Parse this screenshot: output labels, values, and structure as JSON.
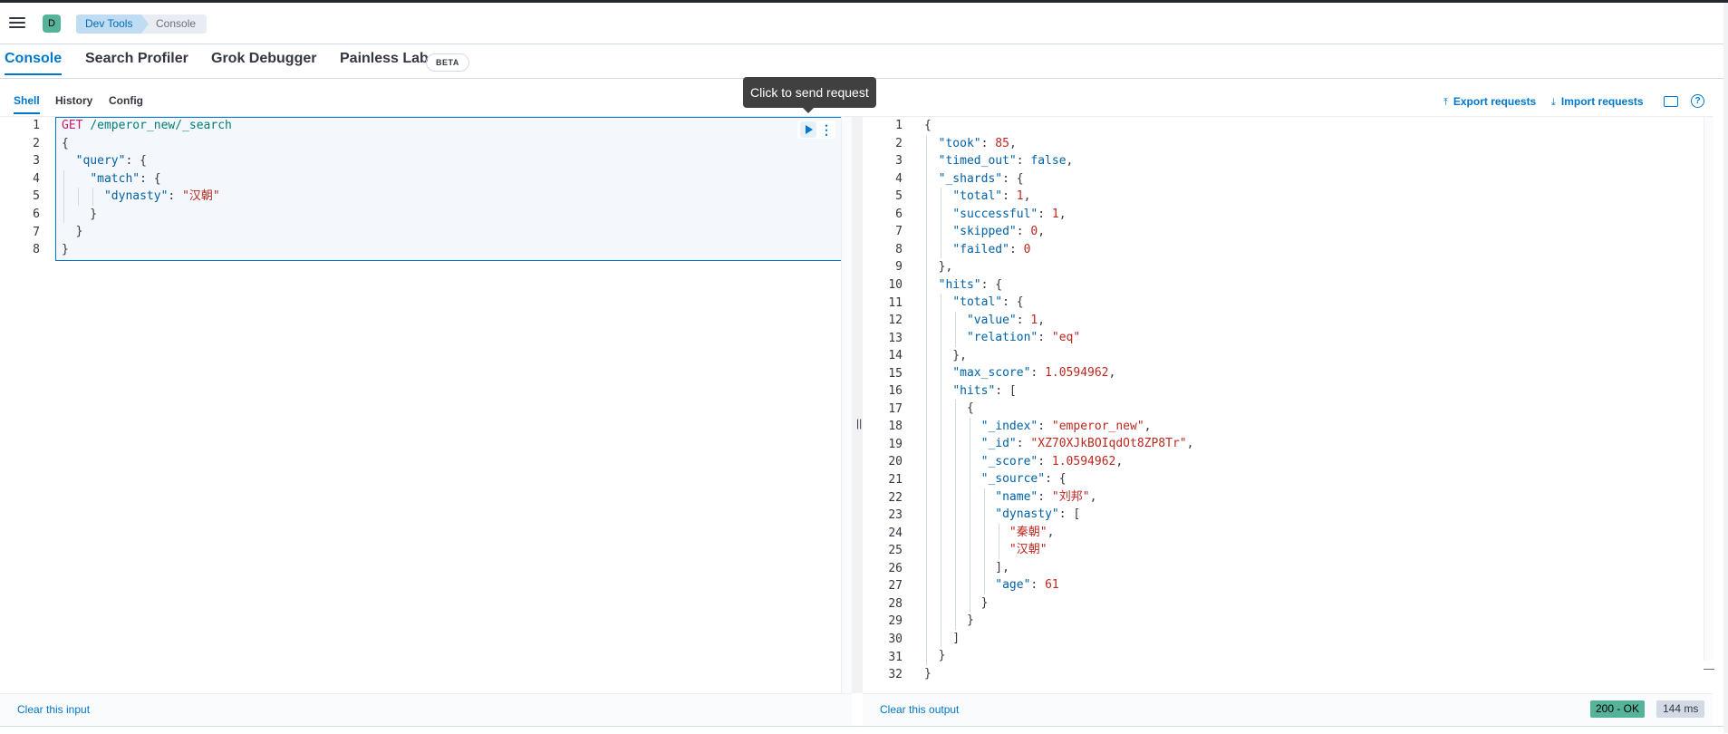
{
  "header": {
    "avatar_letter": "D",
    "breadcrumbs": [
      "Dev Tools",
      "Console"
    ]
  },
  "main_tabs": [
    {
      "label": "Console",
      "active": true
    },
    {
      "label": "Search Profiler",
      "active": false
    },
    {
      "label": "Grok Debugger",
      "active": false
    },
    {
      "label": "Painless Lab",
      "active": false,
      "badge": "BETA"
    }
  ],
  "sub_tabs": [
    {
      "label": "Shell",
      "active": true
    },
    {
      "label": "History",
      "active": false
    },
    {
      "label": "Config",
      "active": false
    }
  ],
  "toolbar": {
    "export_label": "Export requests",
    "import_label": "Import requests"
  },
  "tooltip": "Click to send request",
  "request": {
    "line_numbers": [
      "1",
      "2",
      "3",
      "4",
      "5",
      "6",
      "7",
      "8"
    ],
    "method": "GET",
    "url": "/emperor_new/_search",
    "query_key": "\"query\"",
    "match_key": "\"match\"",
    "dynasty_key": "\"dynasty\"",
    "dynasty_value": "\"汉朝\""
  },
  "response": {
    "line_numbers": [
      "1",
      "2",
      "3",
      "4",
      "5",
      "6",
      "7",
      "8",
      "9",
      "10",
      "11",
      "12",
      "13",
      "14",
      "15",
      "16",
      "17",
      "18",
      "19",
      "20",
      "21",
      "22",
      "23",
      "24",
      "25",
      "26",
      "27",
      "28",
      "29",
      "30",
      "31",
      "32"
    ],
    "took": "85",
    "timed_out": "false",
    "shards_total": "1",
    "shards_successful": "1",
    "shards_skipped": "0",
    "shards_failed": "0",
    "hits_total_value": "1",
    "hits_total_relation": "\"eq\"",
    "max_score": "1.0594962",
    "hit_index": "\"emperor_new\"",
    "hit_id": "\"XZ70XJkBOIqdOt8ZP8Tr\"",
    "hit_score": "1.0594962",
    "source_name": "\"刘邦\"",
    "source_dynasty_1": "\"秦朝\"",
    "source_dynasty_2": "\"汉朝\"",
    "source_age": "61"
  },
  "footer": {
    "clear_input": "Clear this input",
    "clear_output": "Clear this output",
    "status": "200 - OK",
    "time": "144 ms"
  }
}
